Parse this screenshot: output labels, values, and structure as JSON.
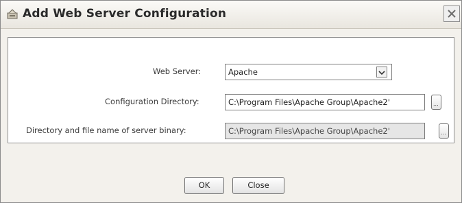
{
  "dialog": {
    "title": "Add Web Server Configuration",
    "icons": {
      "app": "server-config-icon",
      "close": "close-icon"
    }
  },
  "form": {
    "web_server": {
      "label": "Web Server:",
      "value": "Apache"
    },
    "config_dir": {
      "label": "Configuration Directory:",
      "value": "C:\\Program Files\\Apache Group\\Apache2'"
    },
    "binary_path": {
      "label": "Directory and file name of server binary:",
      "value": "C:\\Program Files\\Apache Group\\Apache2'"
    },
    "browse_label": "..."
  },
  "buttons": {
    "ok": "OK",
    "close": "Close"
  },
  "colors": {
    "dialog_bg": "#f3f1ec",
    "panel_bg": "#ffffff",
    "border": "#8d8d8d"
  }
}
